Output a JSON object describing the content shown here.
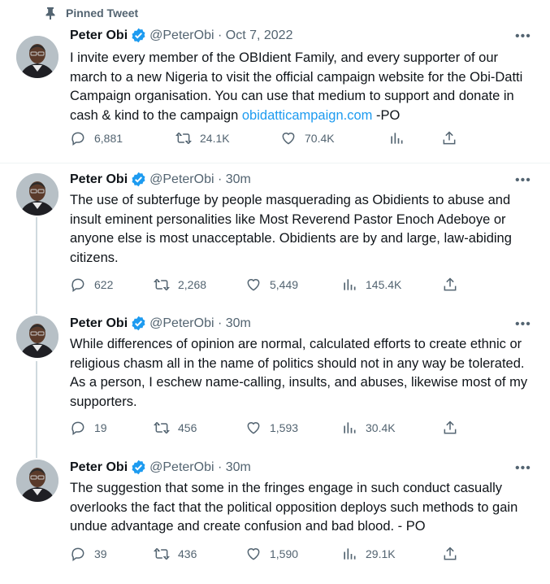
{
  "pinned_label": "Pinned Tweet",
  "author": {
    "name": "Peter Obi",
    "handle": "@PeterObi",
    "verified": true
  },
  "colors": {
    "link": "#1d9bf0",
    "verified_badge": "#1d9bf0",
    "secondary_text": "#536471",
    "primary_text": "#0f1419"
  },
  "tweets": [
    {
      "time": "Oct 7, 2022",
      "text_before_link": "I invite every member of the OBIdient Family, and every supporter of our march to a new Nigeria to visit the official campaign website for the Obi-Datti Campaign organisation. You can use that medium to support and donate in cash & kind to the campaign ",
      "link": "obidatticampaign.com",
      "text_after_link": " -PO",
      "replies": "6,881",
      "retweets": "24.1K",
      "likes": "70.4K",
      "views": ""
    },
    {
      "time": "30m",
      "text": "The use of subterfuge by people masquerading as Obidients to abuse and insult eminent personalities like Most Reverend Pastor Enoch Adeboye or anyone else is most unacceptable. Obidients are by and large, law-abiding citizens.",
      "replies": "622",
      "retweets": "2,268",
      "likes": "5,449",
      "views": "145.4K"
    },
    {
      "time": "30m",
      "text": "While differences of opinion are normal, calculated efforts to create ethnic or religious chasm all in the name of politics should not in any way be tolerated. As a person, I eschew name-calling, insults, and abuses, likewise most of my supporters.",
      "replies": "19",
      "retweets": "456",
      "likes": "1,593",
      "views": "30.4K"
    },
    {
      "time": "30m",
      "text": "The suggestion that some in the fringes engage in such conduct casually overlooks the fact that the political opposition deploys such methods to gain undue advantage and create confusion and bad blood. - PO",
      "replies": "39",
      "retweets": "436",
      "likes": "1,590",
      "views": "29.1K"
    }
  ],
  "separator": " · ",
  "more_glyph": "•••"
}
